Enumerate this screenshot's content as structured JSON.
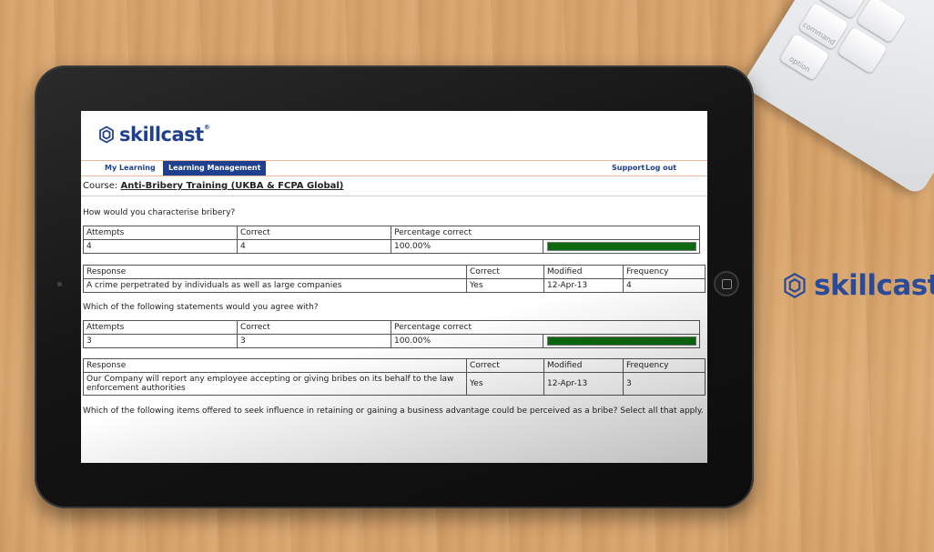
{
  "brand": {
    "name": "skillcast",
    "reg": "®"
  },
  "nav": {
    "my_learning": "My Learning",
    "learning_management": "Learning Management",
    "support": "Support",
    "logout": "Log out"
  },
  "course": {
    "label": "Course:",
    "name": "Anti-Bribery Training (UKBA & FCPA Global)"
  },
  "stats_headers": [
    "Attempts",
    "Correct",
    "Percentage correct"
  ],
  "response_headers": [
    "Response",
    "Correct",
    "Modified",
    "Frequency"
  ],
  "questions": [
    {
      "text": "How would you characterise bribery?",
      "attempts": "4",
      "correct": "4",
      "percentage": "100.00%",
      "progress": 1.0,
      "response": "A crime perpetrated by individuals as well as large companies",
      "response_correct": "Yes",
      "modified": "12-Apr-13",
      "frequency": "4"
    },
    {
      "text": "Which of the following statements would you agree with?",
      "attempts": "3",
      "correct": "3",
      "percentage": "100.00%",
      "progress": 1.0,
      "response": "Our Company will report any employee accepting or giving bribes on its behalf to the law enforcement authorities",
      "response_correct": "Yes",
      "modified": "12-Apr-13",
      "frequency": "3"
    },
    {
      "text": "Which of the following items offered to seek influence in retaining or gaining a business advantage could be perceived as a bribe? Select all that apply."
    }
  ],
  "keyboard": {
    "key_cmd": "command",
    "key_opt": "option"
  },
  "colors": {
    "brand_blue": "#1f3f8f",
    "bar_green": "#0b6a10",
    "nav_rule": "#e8b9a0"
  }
}
